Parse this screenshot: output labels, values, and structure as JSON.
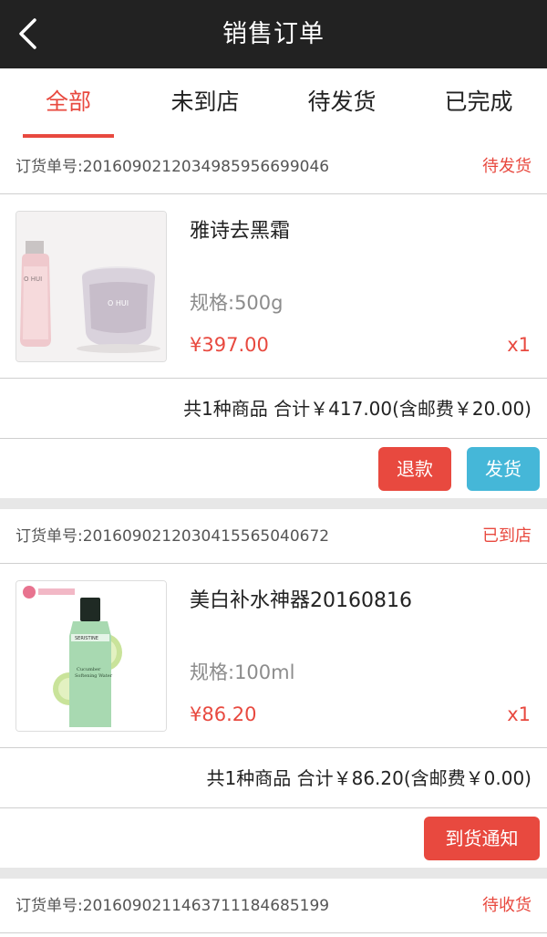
{
  "header": {
    "title": "销售订单",
    "back_icon": "chevron-left-icon"
  },
  "tabs": [
    {
      "label": "全部",
      "active": true
    },
    {
      "label": "未到店",
      "active": false
    },
    {
      "label": "待发货",
      "active": false
    },
    {
      "label": "已完成",
      "active": false
    }
  ],
  "orders": [
    {
      "order_no": "订货单号:2016090212034985956699046",
      "status": "待发货",
      "product": {
        "name": "雅诗去黑霜",
        "spec": "规格:500g",
        "price": "¥397.00",
        "qty": "x1",
        "image": "cosmetic-bottle-and-jar-image"
      },
      "summary": "共1种商品 合计￥417.00(含邮费￥20.00)",
      "actions": [
        "退款",
        "发货"
      ]
    },
    {
      "order_no": "订货单号:2016090212030415565040672",
      "status": "已到店",
      "product": {
        "name": "美白补水神器20160816",
        "spec": "规格:100ml",
        "price": "¥86.20",
        "qty": "x1",
        "image": "cucumber-toner-bottle-image"
      },
      "summary": "共1种商品 合计￥86.20(含邮费￥0.00)",
      "actions": [
        "到货通知"
      ]
    },
    {
      "order_no": "订货单号:2016090211463711184685199",
      "status": "待收货"
    }
  ],
  "colors": {
    "accent": "#e8493f",
    "blue": "#45b7d8",
    "topbar": "#222222"
  }
}
